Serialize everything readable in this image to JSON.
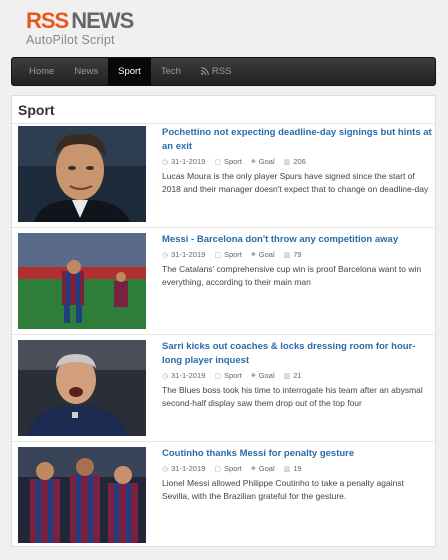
{
  "logo": {
    "rss": "RSS",
    "news": "NEWS",
    "subtitle": "AutoPilot Script"
  },
  "nav": [
    {
      "label": "Home"
    },
    {
      "label": "News"
    },
    {
      "label": "Sport"
    },
    {
      "label": "Tech"
    },
    {
      "label": "RSS"
    }
  ],
  "active_nav": "Sport",
  "section": {
    "title": "Sport"
  },
  "articles": [
    {
      "title": "Pochettino not expecting deadline-day signings but hints at an exit",
      "date": "31-1-2019",
      "category": "Sport",
      "tag": "Goal",
      "views": "206",
      "excerpt": "Lucas Moura is the only player Spurs have signed since the start of 2018 and their manager doesn't expect that to change on deadline-day"
    },
    {
      "title": "Messi - Barcelona don't throw any competition away",
      "date": "31-1-2019",
      "category": "Sport",
      "tag": "Goal",
      "views": "79",
      "excerpt": "The Catalans' comprehensive cup win is proof Barcelona want to win everything, according to their main man"
    },
    {
      "title": "Sarri kicks out coaches & locks dressing room for hour-long player inquest",
      "date": "31-1-2019",
      "category": "Sport",
      "tag": "Goal",
      "views": "21",
      "excerpt": "The Blues boss took his time to interrogate his team after an abysmal second-half display saw them drop out of the top four"
    },
    {
      "title": "Coutinho thanks Messi for penalty gesture",
      "date": "31-1-2019",
      "category": "Sport",
      "tag": "Goal",
      "views": "19",
      "excerpt": "Lionel Messi allowed Philippe Coutinho to take a penalty against Sevilla, with the Brazilian grateful for the gesture."
    }
  ],
  "colors": {
    "accent": "#e8581b",
    "link": "#2a6ca8",
    "nav_bg": "#2b2b2b"
  }
}
